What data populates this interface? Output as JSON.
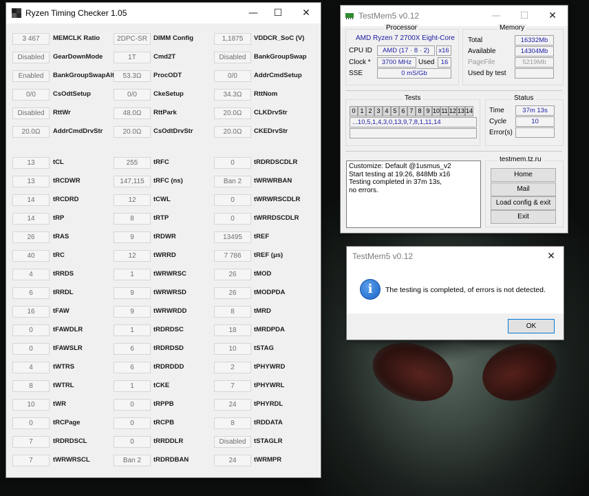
{
  "rtc": {
    "title": "Ryzen Timing Checker 1.05",
    "minimize": "—",
    "maximize": "☐",
    "close": "✕",
    "top_rows": [
      [
        [
          "3 467",
          "MEMCLK Ratio"
        ],
        [
          "2DPC-SR",
          "DIMM Config"
        ],
        [
          "1,1875",
          "VDDCR_SoC (V)"
        ]
      ],
      [
        [
          "Disabled",
          "GearDownMode"
        ],
        [
          "1T",
          "Cmd2T"
        ],
        [
          "Disabled",
          "BankGroupSwap"
        ]
      ],
      [
        [
          "Enabled",
          "BankGroupSwapAlt"
        ],
        [
          "53.3Ω",
          "ProcODT"
        ],
        [
          "0/0",
          "AddrCmdSetup"
        ]
      ],
      [
        [
          "0/0",
          "CsOdtSetup"
        ],
        [
          "0/0",
          "CkeSetup"
        ],
        [
          "34.3Ω",
          "RttNom"
        ]
      ],
      [
        [
          "Disabled",
          "RttWr"
        ],
        [
          "48.0Ω",
          "RttPark"
        ],
        [
          "20.0Ω",
          "CLKDrvStr"
        ]
      ],
      [
        [
          "20.0Ω",
          "AddrCmdDrvStr"
        ],
        [
          "20.0Ω",
          "CsOdtDrvStr"
        ],
        [
          "20.0Ω",
          "CKEDrvStr"
        ]
      ]
    ],
    "timing_rows": [
      [
        [
          "13",
          "tCL"
        ],
        [
          "255",
          "tRFC"
        ],
        [
          "0",
          "tRDRDSCDLR"
        ]
      ],
      [
        [
          "13",
          "tRCDWR"
        ],
        [
          "147,115",
          "tRFC (ns)"
        ],
        [
          "Ban 2",
          "tWRWRBAN"
        ]
      ],
      [
        [
          "14",
          "tRCDRD"
        ],
        [
          "12",
          "tCWL"
        ],
        [
          "0",
          "tWRWRSCDLR"
        ]
      ],
      [
        [
          "14",
          "tRP"
        ],
        [
          "8",
          "tRTP"
        ],
        [
          "0",
          "tWRRDSCDLR"
        ]
      ],
      [
        [
          "26",
          "tRAS"
        ],
        [
          "9",
          "tRDWR"
        ],
        [
          "13495",
          "tREF"
        ]
      ],
      [
        [
          "40",
          "tRC"
        ],
        [
          "12",
          "tWRRD"
        ],
        [
          "7 786",
          "tREF (μs)"
        ]
      ],
      [
        [
          "4",
          "tRRDS"
        ],
        [
          "1",
          "tWRWRSC"
        ],
        [
          "26",
          "tMOD"
        ]
      ],
      [
        [
          "6",
          "tRRDL"
        ],
        [
          "9",
          "tWRWRSD"
        ],
        [
          "26",
          "tMODPDA"
        ]
      ],
      [
        [
          "16",
          "tFAW"
        ],
        [
          "9",
          "tWRWRDD"
        ],
        [
          "8",
          "tMRD"
        ]
      ],
      [
        [
          "0",
          "tFAWDLR"
        ],
        [
          "1",
          "tRDRDSC"
        ],
        [
          "18",
          "tMRDPDA"
        ]
      ],
      [
        [
          "0",
          "tFAWSLR"
        ],
        [
          "6",
          "tRDRDSD"
        ],
        [
          "10",
          "tSTAG"
        ]
      ],
      [
        [
          "4",
          "tWTRS"
        ],
        [
          "6",
          "tRDRDDD"
        ],
        [
          "2",
          "tPHYWRD"
        ]
      ],
      [
        [
          "8",
          "tWTRL"
        ],
        [
          "1",
          "tCKE"
        ],
        [
          "7",
          "tPHYWRL"
        ]
      ],
      [
        [
          "10",
          "tWR"
        ],
        [
          "0",
          "tRPPB"
        ],
        [
          "24",
          "tPHYRDL"
        ]
      ],
      [
        [
          "0",
          "tRCPage"
        ],
        [
          "0",
          "tRCPB"
        ],
        [
          "8",
          "tRDDATA"
        ]
      ],
      [
        [
          "7",
          "tRDRDSCL"
        ],
        [
          "0",
          "tRRDDLR"
        ],
        [
          "Disabled",
          "tSTAGLR"
        ]
      ],
      [
        [
          "7",
          "tWRWRSCL"
        ],
        [
          "Ban 2",
          "tRDRDBAN"
        ],
        [
          "24",
          "tWRMPR"
        ]
      ]
    ],
    "icon_colors": [
      "#1f1f1f",
      "#3a3a3a",
      "#5a5a5a",
      "#2a2a2a"
    ]
  },
  "testmem": {
    "title": "TestMem5 v0.12",
    "minimize": "—",
    "maximize": "☐",
    "close": "✕",
    "processor": {
      "group_title": "Processor",
      "name": "AMD Ryzen 7 2700X Eight-Core",
      "cpu_id_label": "CPU ID",
      "cpu_id_value": "AMD  (17 · 8 · 2)",
      "threads": "x16",
      "clock_label": "Clock *",
      "clock_value": "3700 MHz",
      "used_label": "Used",
      "used_value": "16",
      "sse_label": "SSE",
      "sse_value": "0 mS/Gb"
    },
    "memory": {
      "group_title": "Memory",
      "total_label": "Total",
      "total_value": "16332Mb",
      "available_label": "Available",
      "available_value": "14304Mb",
      "pagefile_label": "PageFile",
      "pagefile_value": "5219Mb",
      "usedbytest_label": "Used by test",
      "usedbytest_value": ""
    },
    "tests": {
      "group_title": "Tests",
      "numbers": [
        "0",
        "1",
        "2",
        "3",
        "4",
        "5",
        "6",
        "7",
        "8",
        "9",
        "10",
        "11",
        "12",
        "13",
        "14"
      ],
      "sequence": "...10,5,1,4,3,0,13,9,7,8,1,11,14",
      "progress": ""
    },
    "status": {
      "group_title": "Status",
      "time_label": "Time",
      "time_value": "37m 13s",
      "cycle_label": "Cycle",
      "cycle_value": "10",
      "errors_label": "Error(s)",
      "errors_value": ""
    },
    "log": {
      "line1": "Customize: Default @1usmus_v2",
      "line2": "Start testing at 19:26, 848Mb x16",
      "line3": "Testing completed in 37m 13s,",
      "line4": "no errors."
    },
    "site": {
      "group_title": "testmem.tz.ru",
      "home": "Home",
      "mail": "Mail",
      "load": "Load config & exit",
      "exit": "Exit"
    }
  },
  "dialog": {
    "title": "TestMem5 v0.12",
    "close": "✕",
    "message": "The testing is completed, of errors is not detected.",
    "ok": "OK",
    "info_glyph": "i"
  }
}
